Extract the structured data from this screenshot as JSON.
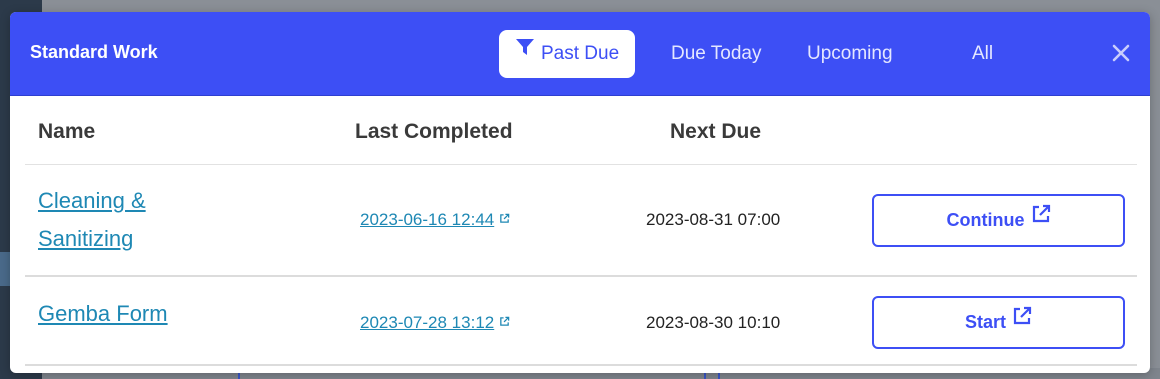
{
  "modal": {
    "title": "Standard Work",
    "close_icon": "close-icon"
  },
  "tabs": [
    {
      "label": "Past Due",
      "active": true,
      "icon": "filter-icon"
    },
    {
      "label": "Due Today",
      "active": false
    },
    {
      "label": "Upcoming",
      "active": false
    },
    {
      "label": "All",
      "active": false
    }
  ],
  "table": {
    "columns": [
      "Name",
      "Last Completed",
      "Next Due"
    ],
    "rows": [
      {
        "name": "Cleaning & Sanitizing",
        "last_completed": "2023-06-16 12:44",
        "next_due": "2023-08-31 07:00",
        "action": "Continue"
      },
      {
        "name": "Gemba Form",
        "last_completed": "2023-07-28 13:12",
        "next_due": "2023-08-30 10:10",
        "action": "Start"
      }
    ]
  },
  "colors": {
    "header_bg": "#3d4ff5",
    "link": "#1e88b4",
    "button_border": "#3d4ff5"
  }
}
